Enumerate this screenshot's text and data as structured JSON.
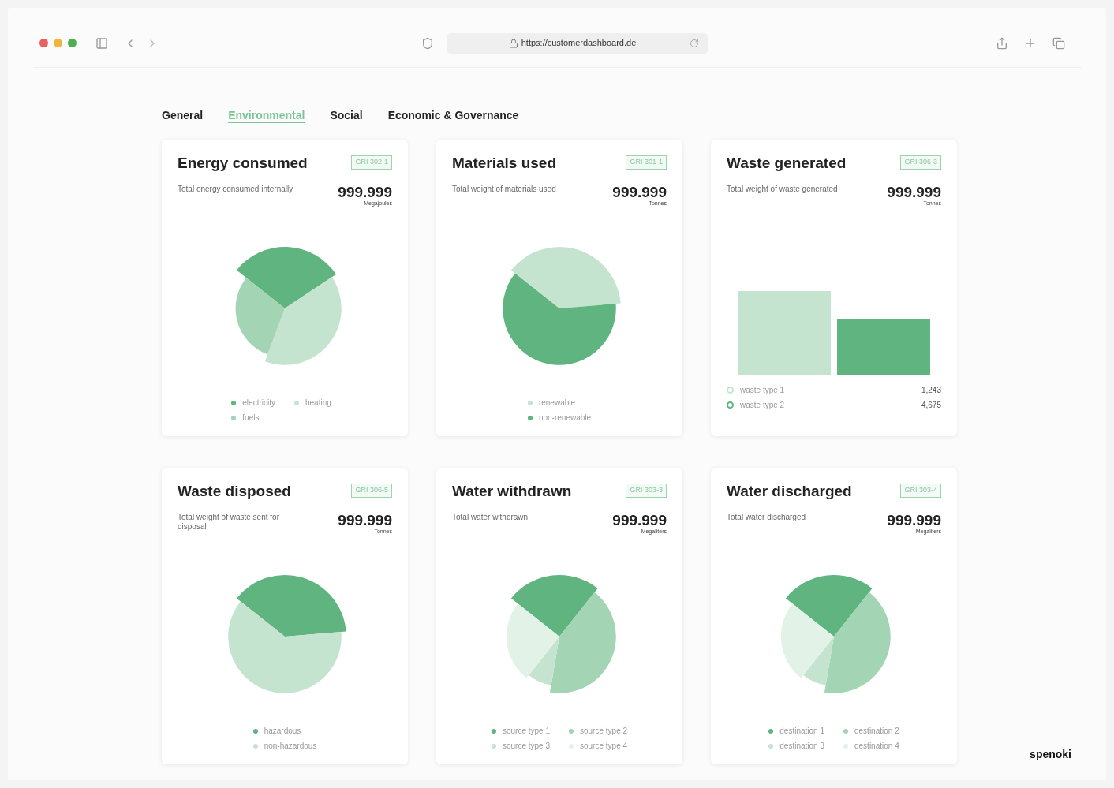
{
  "browser": {
    "url": "https://customerdashboard.de"
  },
  "tabs": [
    {
      "label": "General",
      "selected": false
    },
    {
      "label": "Environmental",
      "selected": true
    },
    {
      "label": "Social",
      "selected": false
    },
    {
      "label": "Economic & Governance",
      "selected": false
    }
  ],
  "cards": [
    {
      "title": "Energy consumed",
      "badge": "GRI 302-1",
      "description": "Total energy consumed internally",
      "value": "999.999",
      "unit": "Megajoules",
      "chart": {
        "kind": "pie"
      },
      "legend": [
        {
          "label": "electricity",
          "color": "#5fb47f"
        },
        {
          "label": "heating",
          "color": "#c5e4cf"
        },
        {
          "label": "fuels",
          "color": "#a3d4b3"
        }
      ]
    },
    {
      "title": "Materials used",
      "badge": "GRI 301-1",
      "description": "Total weight of materials used",
      "value": "999.999",
      "unit": "Tonnes",
      "chart": {
        "kind": "pie"
      },
      "legend": [
        {
          "label": "renewable",
          "color": "#c5e4cf"
        },
        {
          "label": "non-renewable",
          "color": "#5fb47f"
        }
      ]
    },
    {
      "title": "Waste generated",
      "badge": "GRI 306-3",
      "description": "Total weight of waste generated",
      "value": "999.999",
      "unit": "Tonnes",
      "chart": {
        "kind": "bar"
      },
      "legend": [
        {
          "label": "waste type 1",
          "value": "1,243",
          "color": "#c5e4cf"
        },
        {
          "label": "waste type 2",
          "value": "4,675",
          "color": "#5fb47f"
        }
      ]
    },
    {
      "title": "Waste disposed",
      "badge": "GRI 306-5",
      "description": "Total weight of waste sent for disposal",
      "value": "999.999",
      "unit": "Tonnes",
      "chart": {
        "kind": "pie"
      },
      "legend": [
        {
          "label": "hazardous",
          "color": "#5fb47f"
        },
        {
          "label": "non-hazardous",
          "color": "#c5e4cf"
        }
      ]
    },
    {
      "title": "Water withdrawn",
      "badge": "GRI 303-3",
      "description": "Total water withdrawn",
      "value": "999.999",
      "unit": "Megaliters",
      "chart": {
        "kind": "pie"
      },
      "legend": [
        {
          "label": "source type 1",
          "color": "#5fb47f"
        },
        {
          "label": "source type 2",
          "color": "#a3d4b3"
        },
        {
          "label": "source type 3",
          "color": "#c5e4cf"
        },
        {
          "label": "source type 4",
          "color": "#e3f2e7"
        }
      ]
    },
    {
      "title": "Water discharged",
      "badge": "GRI 303-4",
      "description": "Total water discharged",
      "value": "999.999",
      "unit": "Megaliters",
      "chart": {
        "kind": "pie"
      },
      "legend": [
        {
          "label": "destination 1",
          "color": "#5fb47f"
        },
        {
          "label": "destination 2",
          "color": "#a3d4b3"
        },
        {
          "label": "destination 3",
          "color": "#c5e4cf"
        },
        {
          "label": "destination 4",
          "color": "#e3f2e7"
        }
      ]
    }
  ],
  "footer": {
    "logo": "spenoki"
  }
}
